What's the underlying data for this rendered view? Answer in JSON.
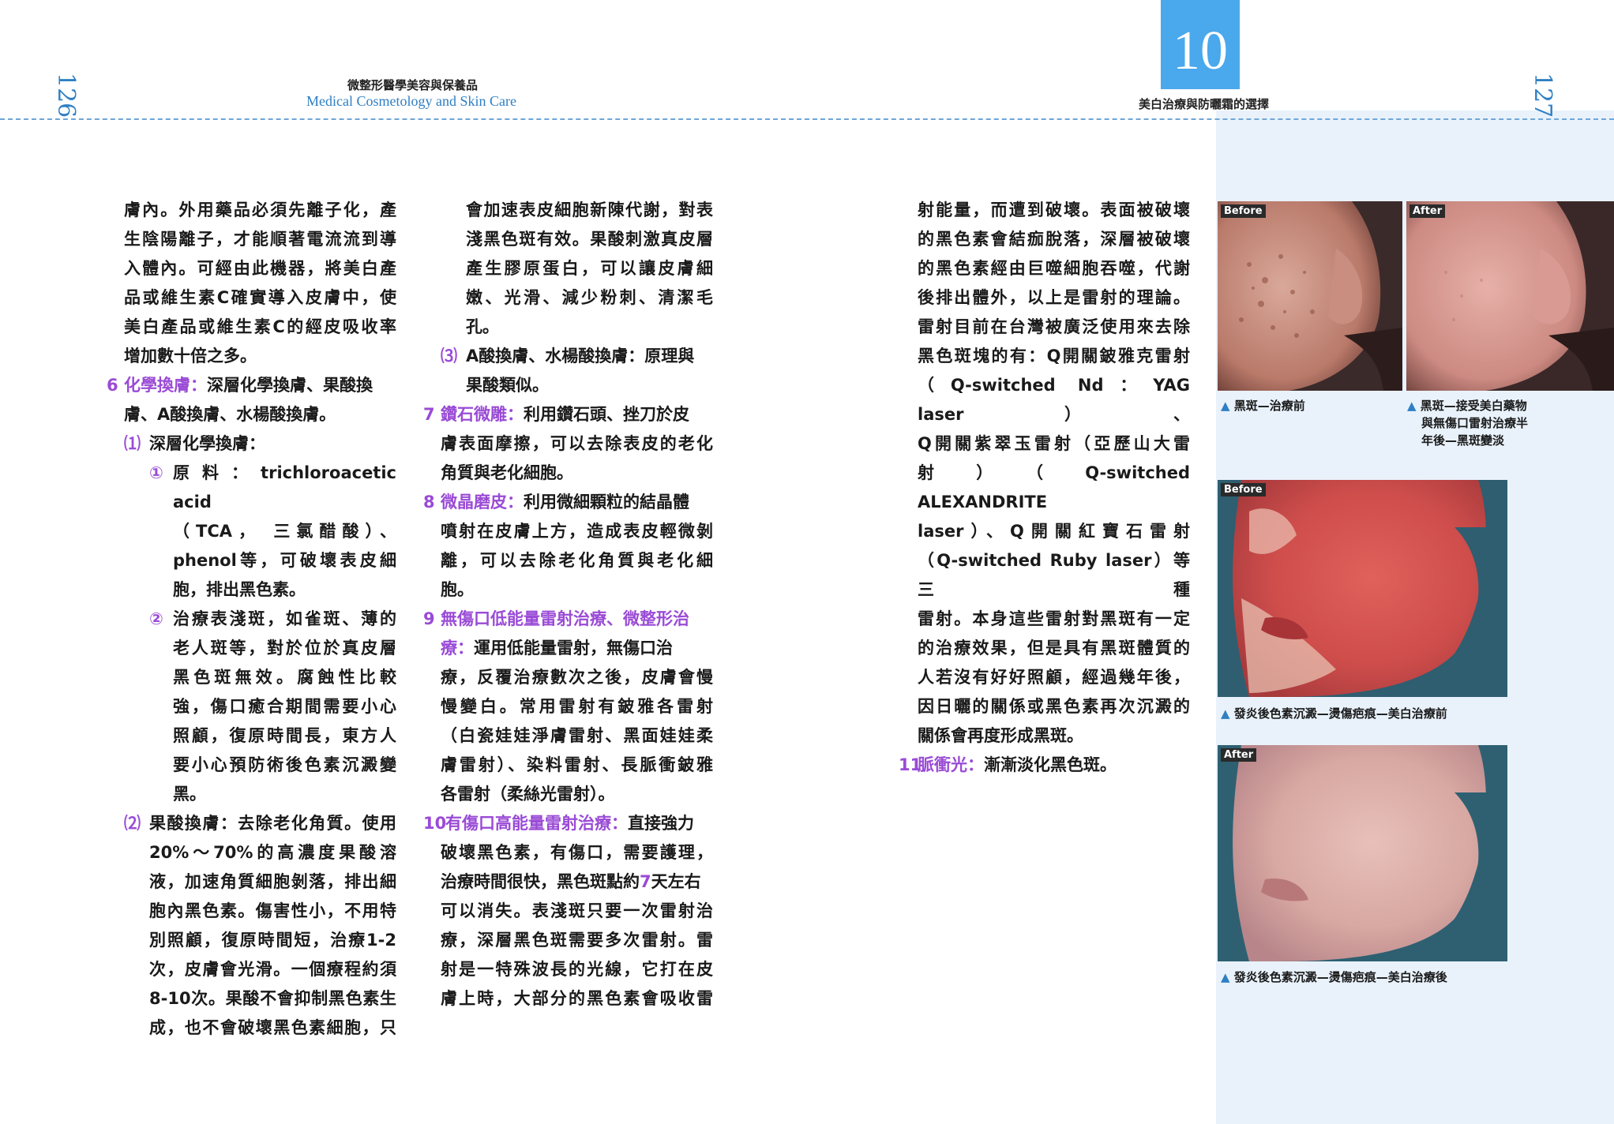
{
  "header": {
    "left_page_number": "126",
    "right_page_number": "127",
    "book_title_cn": "微整形醫學美容與保養品",
    "book_title_en": "Medical Cosmetology and Skin Care",
    "chapter_number": "10",
    "chapter_title": "美白治療與防曬霜的選擇"
  },
  "col1": {
    "intro": [
      "膚內。外用藥品必須先離子化，產",
      "生陰陽離子，才能順著電流流到導",
      "入體內。可經由此機器，將美白產",
      "品或維生素C確實導入皮膚中，使",
      "美白產品或維生素C的經皮吸收率",
      "增加數十倍之多。"
    ],
    "s6_num": "6",
    "s6_head": "化學換膚：",
    "s6_l1": "深層化學換膚、果酸換",
    "s6_l2": "膚、A酸換膚、水楊酸換膚。",
    "p1_mark": "⑴",
    "p1_line": "深層化學換膚：",
    "c1_mark": "①",
    "c1_lines": [
      "原料：trichloroacetic acid",
      "（TCA， 三氯醋酸）、",
      "phenol等，可破壞表皮細",
      "胞，排出黑色素。"
    ],
    "c2_mark": "②",
    "c2_lines": [
      "治療表淺斑，如雀斑、薄的",
      "老人斑等，對於位於真皮層",
      "黑色斑無效。腐蝕性比較",
      "強，傷口癒合期間需要小心",
      "照顧，復原時間長，東方人",
      "要小心預防術後色素沉澱變",
      "黑。"
    ],
    "p2_mark": "⑵",
    "p2_lines": [
      "果酸換膚：去除老化角質。使用",
      "20%～70%的高濃度果酸溶",
      "液，加速角質細胞剝落，排出細",
      "胞內黑色素。傷害性小，不用特",
      "別照顧，復原時間短，治療1-2",
      "次，皮膚會光滑。一個療程約須",
      "8-10次。果酸不會抑制黑色素生",
      "成，也不會破壞黑色素細胞，只"
    ]
  },
  "col2": {
    "cont_lines": [
      "會加速表皮細胞新陳代謝，對表",
      "淺黑色斑有效。果酸刺激真皮層",
      "產生膠原蛋白，可以讓皮膚細",
      "嫩、光滑、減少粉刺、清潔毛",
      "孔。"
    ],
    "p3_mark": "⑶",
    "p3_lines": [
      "A酸換膚、水楊酸換膚：原理與",
      "果酸類似。"
    ],
    "s7_num": "7",
    "s7_head": "鑽石微雕：",
    "s7_l1": "利用鑽石頭、挫刀於皮",
    "s7_rest": [
      "膚表面摩擦，可以去除表皮的老化",
      "角質與老化細胞。"
    ],
    "s8_num": "8",
    "s8_head": "微晶磨皮：",
    "s8_l1": "利用微細顆粒的結晶體",
    "s8_rest": [
      "噴射在皮膚上方，造成表皮輕微剝",
      "離，可以去除老化角質與老化細",
      "胞。"
    ],
    "s9_num": "9",
    "s9_head1": "無傷口低能量雷射治療、微整形治",
    "s9_head2": "療：",
    "s9_l2": "運用低能量雷射，無傷口治",
    "s9_rest": [
      "療，反覆治療數次之後，皮膚會慢",
      "慢變白。常用雷射有鈹雅各雷射",
      "（白瓷娃娃淨膚雷射、黑面娃娃柔",
      "膚雷射）、染料雷射、長脈衝鈹雅",
      "各雷射（柔絲光雷射）。"
    ],
    "s10_num": "10",
    "s10_head": "有傷口高能量雷射治療：",
    "s10_l1": "直接強力",
    "s10_l2": "破壞黑色素，有傷口，需要護理，",
    "s10_l3a": "治療時間很快，黑色斑點約",
    "s10_l3b": "7",
    "s10_l3c": "天左右",
    "s10_rest": [
      "可以消失。表淺斑只要一次雷射治",
      "療，深層黑色斑需要多次雷射。雷",
      "射是一特殊波長的光線，它打在皮",
      "膚上時，大部分的黑色素會吸收雷"
    ]
  },
  "col3": {
    "lines": [
      "射能量，而遭到破壞。表面被破壞",
      "的黑色素會結痂脫落，深層被破壞",
      "的黑色素經由巨噬細胞吞噬，代謝",
      "後排出體外，以上是雷射的理論。",
      "雷射目前在台灣被廣泛使用來去除",
      "黑色斑塊的有：Q開關鈹雅克雷射",
      "（Q-switched Nd：YAG laser）、",
      "Q開關紫翠玉雷射（亞歷山大雷",
      "射）（Q-switched ALEXANDRITE",
      "laser）、Q開關紅寶石雷射",
      "（Q-switched Ruby laser）等三種",
      "雷射。本身這些雷射對黑斑有一定",
      "的治療效果，但是具有黑斑體質的",
      "人若沒有好好照顧，經過幾年後，",
      "因日曬的關係或黑色素再次沉澱的",
      "關係會再度形成黑斑。"
    ],
    "s11_num": "11",
    "s11_head": "脈衝光：",
    "s11_text": "漸漸淡化黑色斑。"
  },
  "photos": {
    "before_tag": "Before",
    "after_tag": "After",
    "cap_triangle": "▲",
    "cap1": "黑斑—治療前",
    "cap2_lines": [
      "黑斑—接受美白藥物",
      "與無傷口雷射治療半",
      "年後—黑斑變淡"
    ],
    "cap3": "發炎後色素沉澱—燙傷疤痕—美白治療前",
    "cap4": "發炎後色素沉澱—燙傷疤痕—美白治療後"
  },
  "colors": {
    "accent_blue": "#2f7fc4",
    "chapter_blue": "#4aa8ec",
    "heading_purple": "#9a4bd6",
    "panel_bg": "#e9f2fb"
  }
}
